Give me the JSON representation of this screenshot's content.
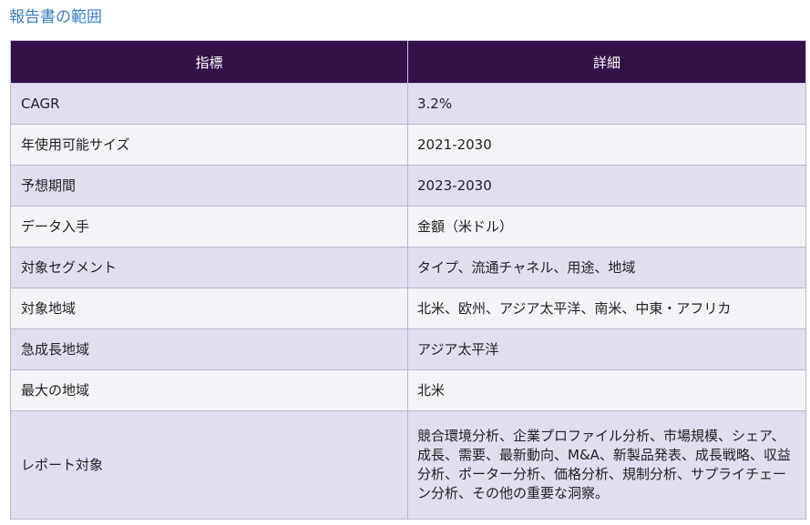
{
  "section_title": "報告書の範囲",
  "table": {
    "headers": [
      "指標",
      "詳細"
    ],
    "rows": [
      {
        "label": "CAGR",
        "value": "3.2%"
      },
      {
        "label": "年使用可能サイズ",
        "value": "2021-2030"
      },
      {
        "label": "予想期間",
        "value": "2023-2030"
      },
      {
        "label": "データ入手",
        "value": "金額（米ドル）"
      },
      {
        "label": "対象セグメント",
        "value": "タイプ、流通チャネル、用途、地域"
      },
      {
        "label": "対象地域",
        "value": "北米、欧州、アジア太平洋、南米、中東・アフリカ"
      },
      {
        "label": "急成長地域",
        "value": "アジア太平洋"
      },
      {
        "label": "最大の地域",
        "value": "北米"
      },
      {
        "label": "レポート対象",
        "value": "競合環境分析、企業プロファイル分析、市場規模、シェア、成長、需要、最新動向、M&A、新製品発表、成長戦略、収益分析、ポーター分析、価格分析、規制分析、サプライチェーン分析、その他の重要な洞察。"
      }
    ]
  },
  "colors": {
    "title": "#3a7fc1",
    "header_bg": "#331149",
    "row_odd": "#e2def0",
    "row_even": "#f4f3f8"
  }
}
